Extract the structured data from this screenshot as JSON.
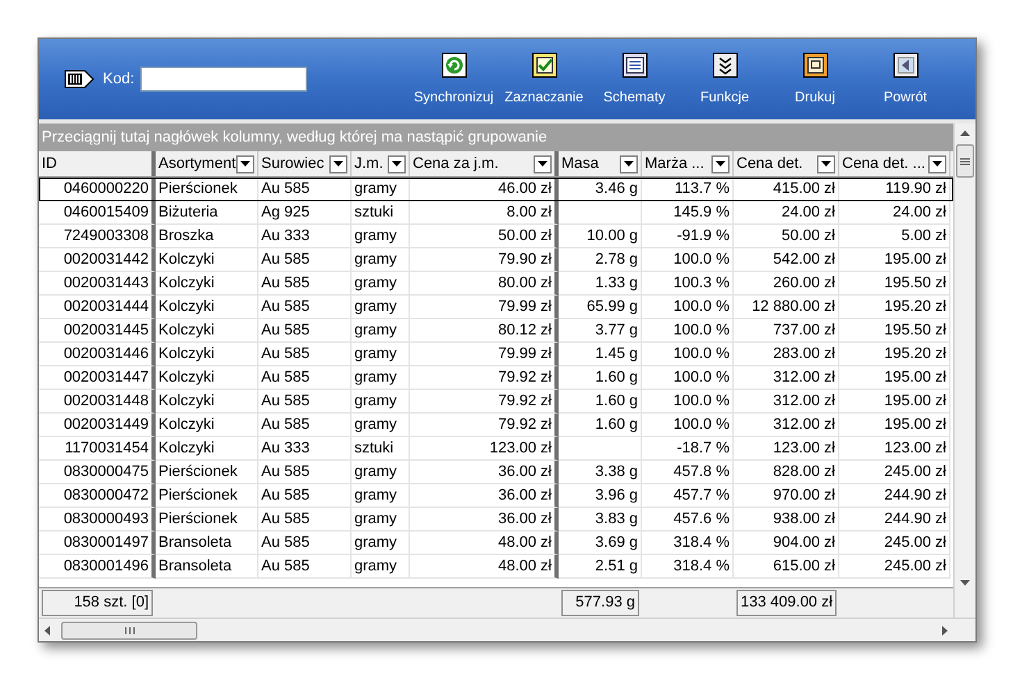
{
  "toolbar": {
    "code_label": "Kod:",
    "buttons": [
      {
        "label": "Synchronizuj",
        "kind": "sync"
      },
      {
        "label": "Zaznaczanie",
        "kind": "check"
      },
      {
        "label": "Schematy",
        "kind": "list"
      },
      {
        "label": "Funkcje",
        "kind": "chevrons"
      },
      {
        "label": "Drukuj",
        "kind": "print"
      },
      {
        "label": "Powrót",
        "kind": "back"
      }
    ]
  },
  "group_panel": {
    "hint": "Przeciągnij tutaj nagłówek kolumny, według której ma nastąpić grupowanie"
  },
  "table": {
    "columns": [
      {
        "label": "ID",
        "dropdown": false
      },
      {
        "label": "Asortyment",
        "dropdown": true
      },
      {
        "label": "Surowiec",
        "dropdown": true
      },
      {
        "label": "J.m.",
        "dropdown": true
      },
      {
        "label": "Cena za j.m.",
        "dropdown": true
      },
      {
        "label": "Masa",
        "dropdown": true
      },
      {
        "label": "Marża ...",
        "dropdown": true
      },
      {
        "label": "Cena det.",
        "dropdown": true
      },
      {
        "label": "Cena det. ...",
        "dropdown": true
      }
    ],
    "rows": [
      {
        "selected": true,
        "cells": [
          "0460000220",
          "Pierścionek",
          "Au 585",
          "gramy",
          "46.00 zł",
          "3.46 g",
          "113.7 %",
          "415.00 zł",
          "119.90 zł"
        ]
      },
      {
        "selected": false,
        "cells": [
          "0460015409",
          "Biżuteria",
          "Ag 925",
          "sztuki",
          "8.00 zł",
          null,
          "145.9 %",
          "24.00 zł",
          "24.00 zł"
        ]
      },
      {
        "selected": false,
        "cells": [
          "7249003308",
          "Broszka",
          "Au 333",
          "gramy",
          "50.00 zł",
          "10.00 g",
          "-91.9 %",
          "50.00 zł",
          "5.00 zł"
        ]
      },
      {
        "selected": false,
        "cells": [
          "0020031442",
          "Kolczyki",
          "Au 585",
          "gramy",
          "79.90 zł",
          "2.78 g",
          "100.0 %",
          "542.00 zł",
          "195.00 zł"
        ]
      },
      {
        "selected": false,
        "cells": [
          "0020031443",
          "Kolczyki",
          "Au 585",
          "gramy",
          "80.00 zł",
          "1.33 g",
          "100.3 %",
          "260.00 zł",
          "195.50 zł"
        ]
      },
      {
        "selected": false,
        "cells": [
          "0020031444",
          "Kolczyki",
          "Au 585",
          "gramy",
          "79.99 zł",
          "65.99 g",
          "100.0 %",
          "12 880.00 zł",
          "195.20 zł"
        ]
      },
      {
        "selected": false,
        "cells": [
          "0020031445",
          "Kolczyki",
          "Au 585",
          "gramy",
          "80.12 zł",
          "3.77 g",
          "100.0 %",
          "737.00 zł",
          "195.50 zł"
        ]
      },
      {
        "selected": false,
        "cells": [
          "0020031446",
          "Kolczyki",
          "Au 585",
          "gramy",
          "79.99 zł",
          "1.45 g",
          "100.0 %",
          "283.00 zł",
          "195.20 zł"
        ]
      },
      {
        "selected": false,
        "cells": [
          "0020031447",
          "Kolczyki",
          "Au 585",
          "gramy",
          "79.92 zł",
          "1.60 g",
          "100.0 %",
          "312.00 zł",
          "195.00 zł"
        ]
      },
      {
        "selected": false,
        "cells": [
          "0020031448",
          "Kolczyki",
          "Au 585",
          "gramy",
          "79.92 zł",
          "1.60 g",
          "100.0 %",
          "312.00 zł",
          "195.00 zł"
        ]
      },
      {
        "selected": false,
        "cells": [
          "0020031449",
          "Kolczyki",
          "Au 585",
          "gramy",
          "79.92 zł",
          "1.60 g",
          "100.0 %",
          "312.00 zł",
          "195.00 zł"
        ]
      },
      {
        "selected": false,
        "cells": [
          "1170031454",
          "Kolczyki",
          "Au 333",
          "sztuki",
          "123.00 zł",
          null,
          "-18.7 %",
          "123.00 zł",
          "123.00 zł"
        ]
      },
      {
        "selected": false,
        "cells": [
          "0830000475",
          "Pierścionek",
          "Au 585",
          "gramy",
          "36.00 zł",
          "3.38 g",
          "457.8 %",
          "828.00 zł",
          "245.00 zł"
        ]
      },
      {
        "selected": false,
        "cells": [
          "0830000472",
          "Pierścionek",
          "Au 585",
          "gramy",
          "36.00 zł",
          "3.96 g",
          "457.7 %",
          "970.00 zł",
          "244.90 zł"
        ]
      },
      {
        "selected": false,
        "cells": [
          "0830000493",
          "Pierścionek",
          "Au 585",
          "gramy",
          "36.00 zł",
          "3.83 g",
          "457.6 %",
          "938.00 zł",
          "244.90 zł"
        ]
      },
      {
        "selected": false,
        "cells": [
          "0830001497",
          "Bransoleta",
          "Au 585",
          "gramy",
          "48.00 zł",
          "3.69 g",
          "318.4 %",
          "904.00 zł",
          "245.00 zł"
        ]
      },
      {
        "selected": false,
        "cells": [
          "0830001496",
          "Bransoleta",
          "Au 585",
          "gramy",
          "48.00 zł",
          "2.51 g",
          "318.4 %",
          "615.00 zł",
          "245.00 zł"
        ]
      }
    ],
    "footer": {
      "id_total": "158 szt. [0]",
      "masa_total": "577.93 g",
      "cena_det_total": "133 409.00 zł"
    }
  }
}
